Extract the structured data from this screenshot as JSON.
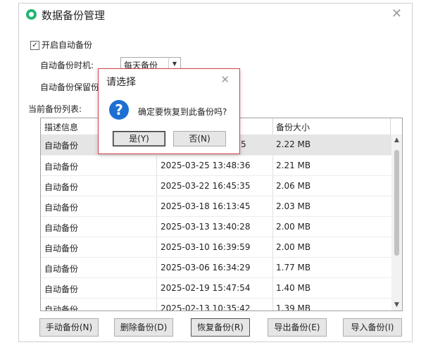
{
  "window": {
    "title": "数据备份管理",
    "close": "✕"
  },
  "settings": {
    "enable_checked": "✓",
    "enable_label": "开启自动备份",
    "timing_label": "自动备份时机:",
    "timing_value": "每天备份",
    "retention_label": "自动备份保留份",
    "list_label": "当前备份列表:"
  },
  "table": {
    "headers": [
      "描述信息",
      "",
      "备份大小"
    ],
    "rows": [
      {
        "desc": "自动备份",
        "time": "",
        "size": "2.22 MB",
        "selected": true,
        "time_partial": "5"
      },
      {
        "desc": "自动备份",
        "time": "2025-03-25 13:48:36",
        "size": "2.21 MB"
      },
      {
        "desc": "自动备份",
        "time": "2025-03-22 16:45:35",
        "size": "2.06 MB"
      },
      {
        "desc": "自动备份",
        "time": "2025-03-18 16:13:45",
        "size": "2.03 MB"
      },
      {
        "desc": "自动备份",
        "time": "2025-03-13 13:40:28",
        "size": "2.00 MB"
      },
      {
        "desc": "自动备份",
        "time": "2025-03-10 16:39:59",
        "size": "2.00 MB"
      },
      {
        "desc": "自动备份",
        "time": "2025-03-06 16:34:29",
        "size": "1.77 MB"
      },
      {
        "desc": "自动备份",
        "time": "2025-02-19 15:47:54",
        "size": "1.40 MB"
      },
      {
        "desc": "自动备份",
        "time": "2025-02-13 10:35:42",
        "size": "1.39 MB"
      }
    ]
  },
  "buttons": {
    "manual": "手动备份(N)",
    "delete": "删除备份(D)",
    "restore": "恢复备份(R)",
    "export": "导出备份(E)",
    "import": "导入备份(I)"
  },
  "dialog": {
    "title": "请选择",
    "close": "✕",
    "icon": "?",
    "message": "确定要恢复到此备份吗?",
    "yes": "是(Y)",
    "no": "否(N)"
  },
  "icons": {
    "app": "shield-icon",
    "question": "question-icon"
  },
  "colors": {
    "accent_green": "#22b573",
    "dialog_border": "#d4424b",
    "question_blue": "#1e6fd2"
  }
}
